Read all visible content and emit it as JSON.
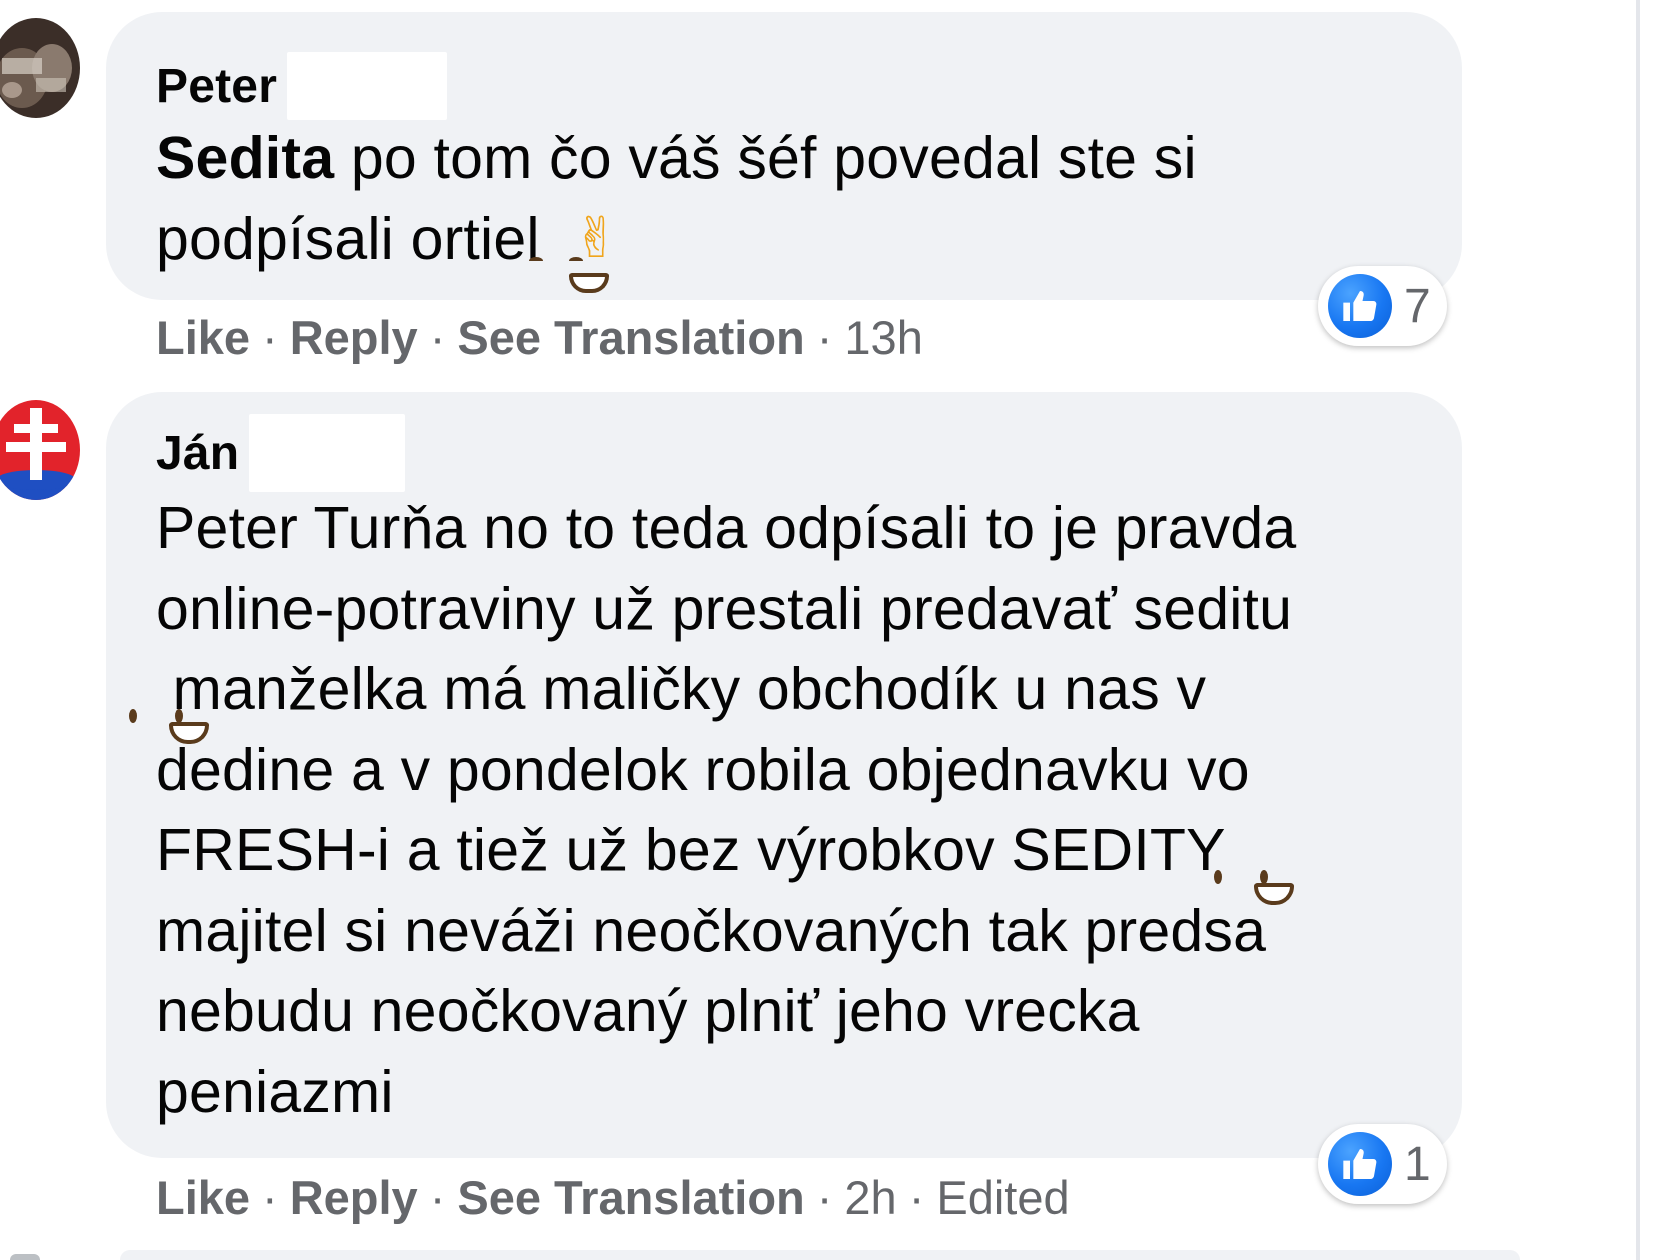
{
  "comments": [
    {
      "author": "Peter",
      "mention": "Sedita",
      "text_after_mention": " po tom čo váš šéf povedal ste si\npodpísali ortiel ",
      "emojis": [
        "grinning-face-with-smiling-eyes",
        "victory-hand"
      ],
      "reaction_count": "7",
      "actions": {
        "like": "Like",
        "reply": "Reply",
        "translate": "See Translation",
        "time": "13h",
        "edited": ""
      }
    },
    {
      "author": "Ján",
      "text_part1": "Peter Turňa no to teda odpísali to je pravda\nonline-potraviny už prestali predavať seditu\n",
      "text_part2": " manželka má maličky obchodík u nas v\ndedine a v pondelok robila objednavku vo\nFRESH-i a tiež už bez výrobkov SEDITY ",
      "text_part3": "\nmajitel si neváži neočkovaných tak predsa\nnebudu neočkovaný plniť jeho vrecka\npeniazmi",
      "emojis": [
        "grinning-face",
        "grinning-face"
      ],
      "reaction_count": "1",
      "actions": {
        "like": "Like",
        "reply": "Reply",
        "translate": "See Translation",
        "time": "2h",
        "edited": "Edited"
      }
    }
  ],
  "colors": {
    "bubble": "#f0f2f5",
    "like_blue": "#1877f2",
    "secondary_text": "#65676b"
  },
  "icons": {
    "reaction": "like-thumbs-up-icon",
    "avatar_ján": "slovak-coat-of-arms-icon"
  }
}
